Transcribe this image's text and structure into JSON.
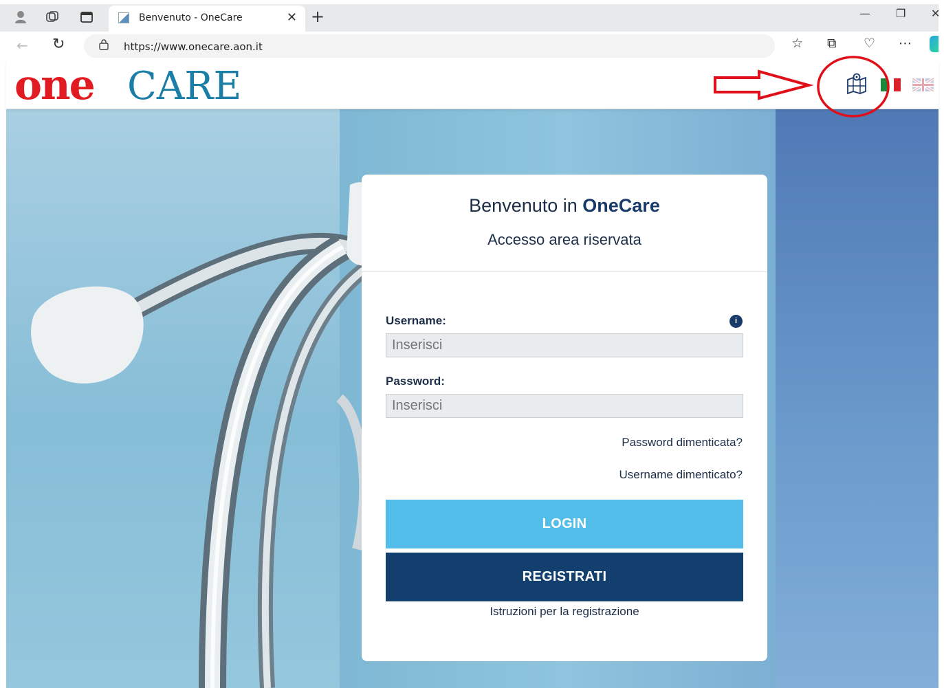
{
  "browser": {
    "tab_title": "Benvenuto - OneCare",
    "url": "https://www.onecare.aon.it",
    "icons": [
      "profile-icon",
      "workspaces-icon",
      "tab-actions-icon",
      "back-icon",
      "reload-icon",
      "lock-icon",
      "favorites-icon",
      "collections-icon",
      "browser-essentials-icon",
      "more-icon",
      "copilot-icon",
      "minimize-icon",
      "restore-icon",
      "close-icon"
    ]
  },
  "site": {
    "logo_one": "one",
    "logo_care": "CARE",
    "header_icons": [
      "map-icon",
      "italian-flag-icon",
      "uk-flag-icon"
    ]
  },
  "login": {
    "welcome_prefix": "Benvenuto in ",
    "welcome_brand": "OneCare",
    "subtitle": "Accesso area riservata",
    "username_label": "Username:",
    "username_placeholder": "Inserisci",
    "password_label": "Password:",
    "password_placeholder": "Inserisci",
    "forgot_password": "Password dimenticata?",
    "forgot_username": "Username dimenticato?",
    "login_button": "LOGIN",
    "register_button": "REGISTRATI",
    "registration_instructions": "Istruzioni per la registrazione"
  },
  "colors": {
    "brand_red": "#e11b22",
    "brand_teal": "#1a7ea6",
    "login_blue": "#53bde9",
    "register_navy": "#123f6d",
    "annotation_red": "#e0101a"
  }
}
